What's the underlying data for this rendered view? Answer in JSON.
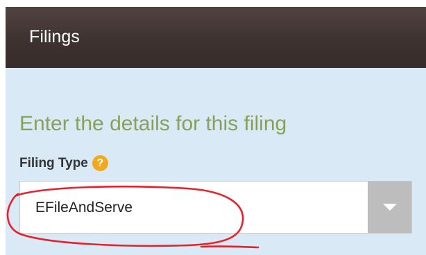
{
  "panel": {
    "title": "Filings"
  },
  "form": {
    "heading": "Enter the details for this filing",
    "filing_type": {
      "label": "Filing Type",
      "help_icon": "question-circle-icon",
      "help_glyph": "?",
      "selected_value": "EFileAndServe",
      "dropdown_icon": "chevron-down-icon"
    }
  },
  "colors": {
    "header_bg": "#3e3230",
    "body_bg": "#d9eaf6",
    "heading_text": "#8aa05a",
    "help_icon_bg": "#f2aa1c",
    "dropdown_button_bg": "#bdbdbd",
    "annotation_stroke": "#e8202a"
  }
}
